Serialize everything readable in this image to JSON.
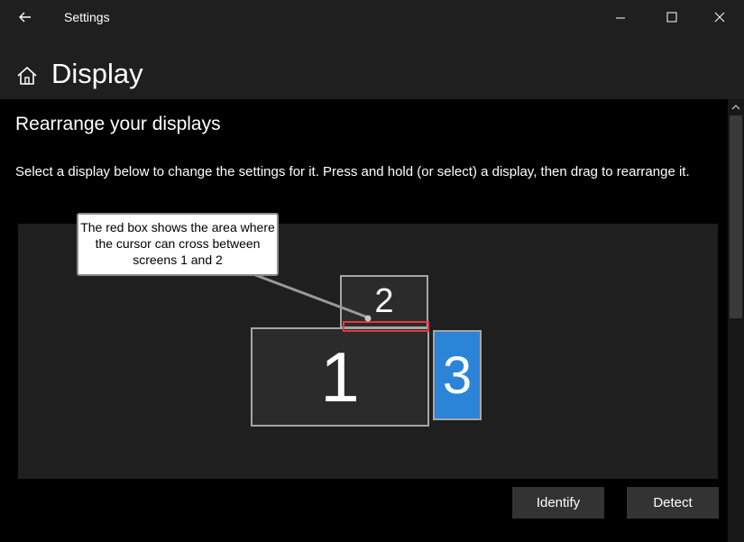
{
  "window": {
    "app_title": "Settings",
    "back_icon": "back-arrow-icon",
    "minimize_icon": "minimize-icon",
    "maximize_icon": "maximize-icon",
    "close_icon": "close-icon"
  },
  "header": {
    "home_icon": "home-icon",
    "page_title": "Display"
  },
  "section": {
    "title": "Rearrange your displays",
    "description": "Select a display below to change the settings for it. Press and hold (or select) a display, then drag to rearrange it."
  },
  "displays": [
    {
      "label": "1",
      "selected": false
    },
    {
      "label": "2",
      "selected": false
    },
    {
      "label": "3",
      "selected": true
    }
  ],
  "annotation": {
    "callout_text": "The red box shows the area where the cursor can cross between screens 1 and 2"
  },
  "buttons": {
    "identify": "Identify",
    "detect": "Detect"
  },
  "colors": {
    "selected_display": "#2b84d7",
    "annotation_box": "#e0383e",
    "panel_background": "#1f1f1f"
  }
}
